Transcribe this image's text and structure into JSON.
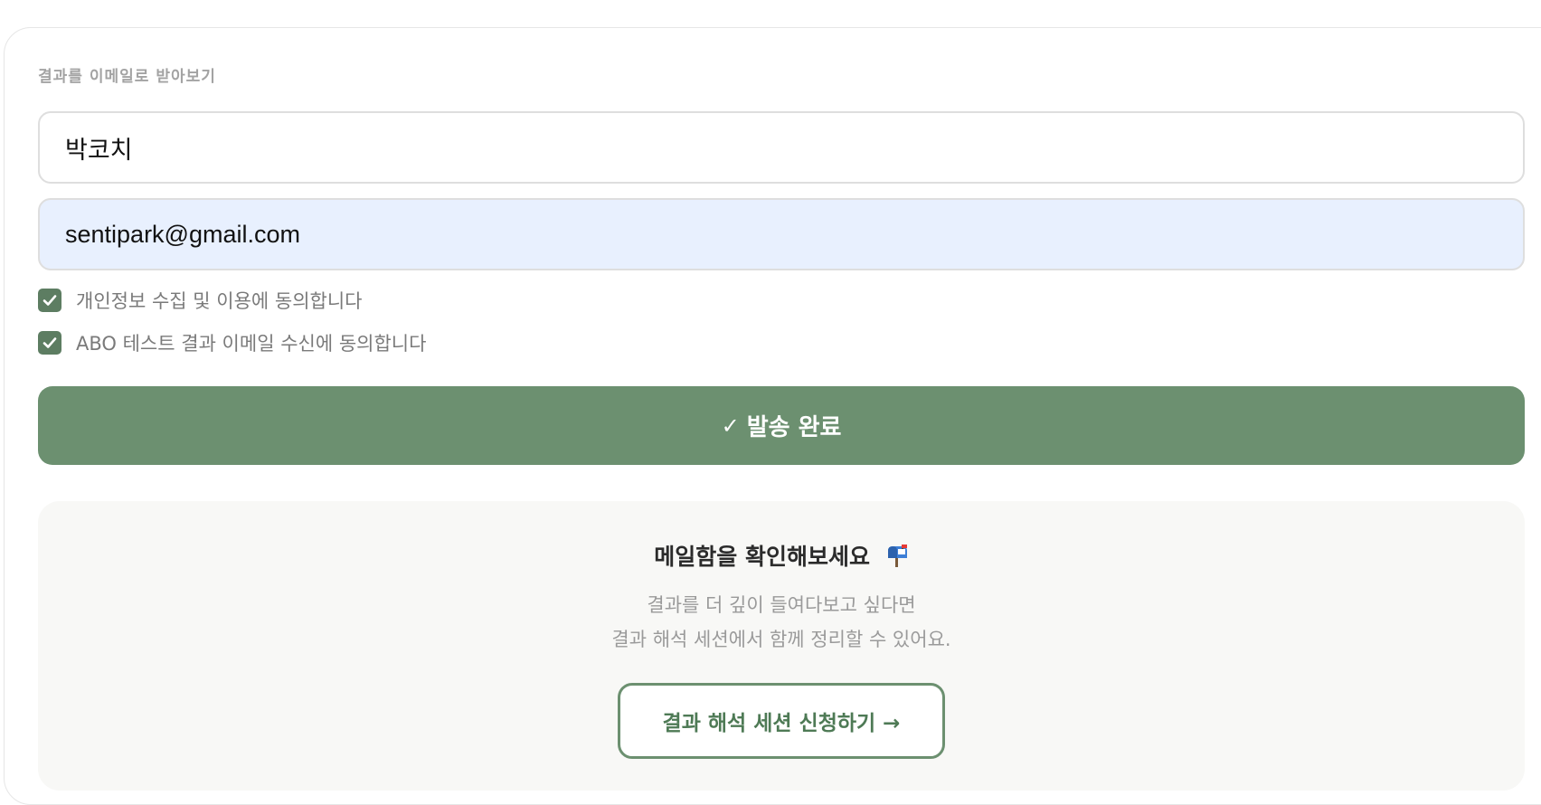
{
  "form": {
    "section_label": "결과를 이메일로 받아보기",
    "name_value": "박코치",
    "email_value": "sentipark@gmail.com",
    "consents": [
      {
        "label": "개인정보 수집 및 이용에 동의합니다",
        "checked": true
      },
      {
        "label": "ABO 테스트 결과 이메일 수신에 동의합니다",
        "checked": true
      }
    ],
    "submit_check": "✓",
    "submit_label": "발송 완료"
  },
  "info": {
    "title": "메일함을 확인해보세요",
    "title_icon": "mailbox-icon",
    "desc_line1": "결과를 더 깊이 들여다보고 싶다면",
    "desc_line2": "결과 해석 세션에서 함께 정리할 수 있어요.",
    "session_button_label": "결과 해석 세션 신청하기 →"
  },
  "colors": {
    "accent": "#6c9070",
    "checkbox": "#5d7d62",
    "email_autofill_bg": "#e8f0fe",
    "info_bg": "#f8f8f6"
  }
}
